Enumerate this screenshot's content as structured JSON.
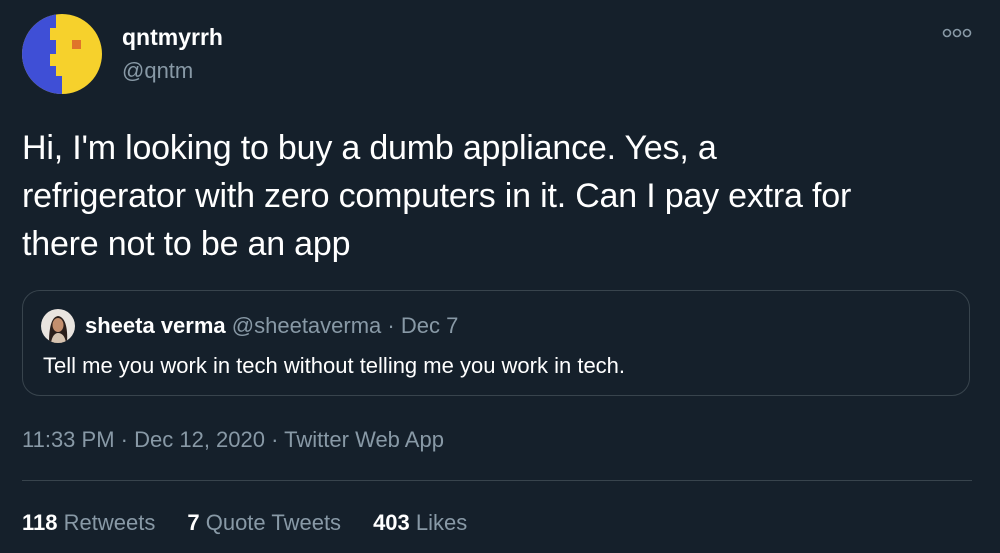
{
  "author": {
    "name": "qntmyrrh",
    "handle": "@qntm",
    "avatar_icon": "pixel-face-avatar"
  },
  "tweet": {
    "lines": [
      "Hi, I'm looking to buy a dumb appliance. Yes, a",
      "refrigerator with zero computers in it. Can I pay extra for",
      "there not to be an app"
    ]
  },
  "quote": {
    "name": "sheeta verma",
    "handle": "@sheetaverma",
    "separator": "·",
    "date": "Dec 7",
    "text": "Tell me you work in tech without telling me you work in tech.",
    "avatar_icon": "profile-photo-avatar"
  },
  "meta": {
    "time": "11:33 PM",
    "date": "Dec 12, 2020",
    "source": "Twitter Web App",
    "separator": "·"
  },
  "stats": {
    "retweets_count": "118",
    "retweets_label": "Retweets",
    "quotes_count": "7",
    "quotes_label": "Quote Tweets",
    "likes_count": "403",
    "likes_label": "Likes"
  },
  "colors": {
    "background": "#15202b",
    "text_primary": "#ffffff",
    "text_secondary": "#8899a6",
    "border": "#38444d",
    "avatar_yellow": "#f6d12c",
    "avatar_blue": "#3f4fd6",
    "avatar_orange": "#e0742a"
  }
}
